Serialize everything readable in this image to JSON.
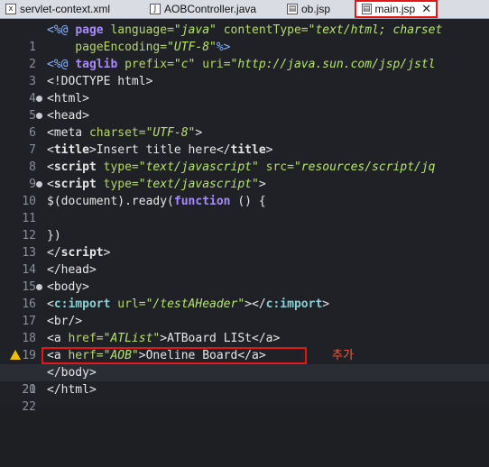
{
  "tabs": [
    {
      "label": "servlet-context.xml",
      "icon": "xml-file-icon"
    },
    {
      "label": "AOBController.java",
      "icon": "java-file-icon"
    },
    {
      "label": "ob.jsp",
      "icon": "jsp-file-icon"
    },
    {
      "label": "main.jsp",
      "icon": "jsp-file-icon",
      "active": true,
      "close": "✕"
    }
  ],
  "lines": [
    {
      "n": "1"
    },
    {
      "n": "2"
    },
    {
      "n": "3"
    },
    {
      "n": "4"
    },
    {
      "n": "5"
    },
    {
      "n": "6"
    },
    {
      "n": "7"
    },
    {
      "n": "8"
    },
    {
      "n": "9"
    },
    {
      "n": "10"
    },
    {
      "n": "11"
    },
    {
      "n": "12"
    },
    {
      "n": "13"
    },
    {
      "n": "14"
    },
    {
      "n": "15"
    },
    {
      "n": "16"
    },
    {
      "n": "17"
    },
    {
      "n": "18"
    },
    {
      "n": "19"
    },
    {
      "n": "20"
    },
    {
      "n": "21"
    },
    {
      "n": "22"
    }
  ],
  "code": {
    "l1_a": "<%@ ",
    "l1_b": "page ",
    "l1_c": "language=",
    "l1_d": "\"java\"",
    "l1_e": " contentType=",
    "l1_f": "\"text/html; charset",
    "l2_a": "    pageEncoding=",
    "l2_b": "\"UTF-8\"",
    "l2_c": "%>",
    "l3_a": "<%@ ",
    "l3_b": "taglib ",
    "l3_c": "prefix=",
    "l3_d": "\"c\"",
    "l3_e": " uri=",
    "l3_f": "\"http://java.sun.com/jsp/jstl",
    "l4": "<!DOCTYPE html>",
    "l5": "<html>",
    "l6": "<head>",
    "l7_a": "<meta ",
    "l7_b": "charset=",
    "l7_c": "\"UTF-8\"",
    "l7_d": ">",
    "l8_a": "<",
    "l8_b": "title",
    "l8_c": ">Insert title here</",
    "l8_d": "title",
    "l8_e": ">",
    "l9_a": "<",
    "l9_b": "script ",
    "l9_c": "type=",
    "l9_d": "\"text/javascript\"",
    "l9_e": " src=",
    "l9_f": "\"resources/script/jq",
    "l10_a": "<",
    "l10_b": "script ",
    "l10_c": "type=",
    "l10_d": "\"text/javascript\"",
    "l10_e": ">",
    "l11_a": "$(document).ready(",
    "l11_b": "function",
    "l11_c": " () {",
    "l12": "",
    "l13": "})",
    "l14_a": "</",
    "l14_b": "script",
    "l14_c": ">",
    "l15": "</head>",
    "l16": "<body>",
    "l17_a": "<",
    "l17_b": "c:import",
    "l17_c": " url=",
    "l17_d": "\"/testAHeader\"",
    "l17_e": "></",
    "l17_f": "c:import",
    "l17_g": ">",
    "l18": "<br/>",
    "l19_a": "<a ",
    "l19_b": "href=",
    "l19_c": "\"ATList\"",
    "l19_d": ">ATBoard LISt</a>",
    "l20_a": "<a ",
    "l20_b": "herf=",
    "l20_c": "\"AOB\"",
    "l20_d": ">Oneline Board</a>",
    "l21": "</body>",
    "l22": "</html>"
  },
  "annotation": "추가",
  "colors": {
    "highlight_box": "#e61616",
    "annotation": "#ff5a3c"
  }
}
